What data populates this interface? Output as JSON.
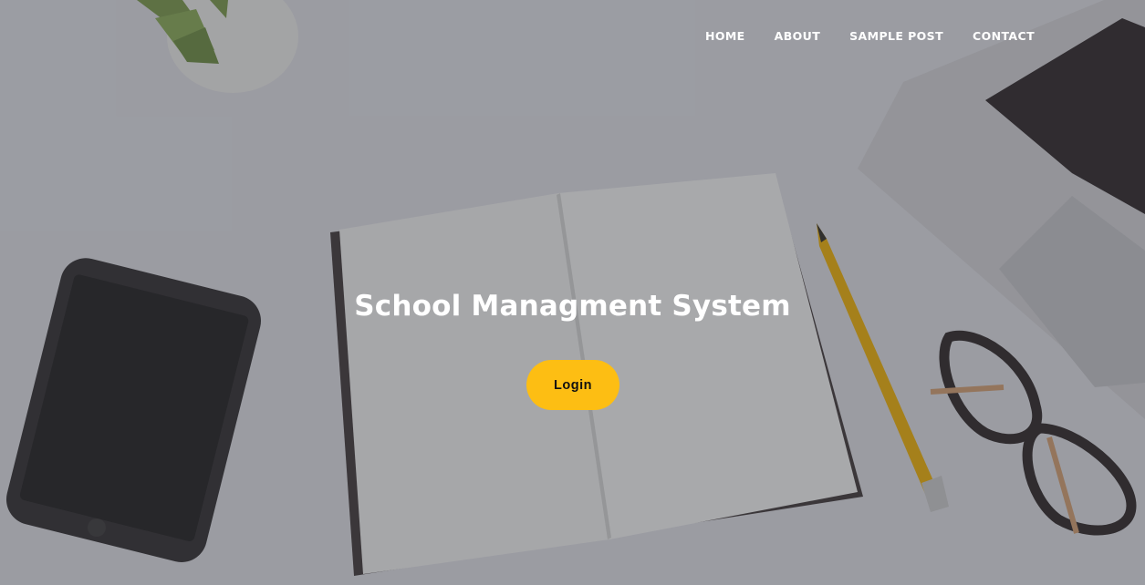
{
  "nav": {
    "items": [
      {
        "label": "HOME"
      },
      {
        "label": "ABOUT"
      },
      {
        "label": "SAMPLE POST"
      },
      {
        "label": "CONTACT"
      }
    ]
  },
  "hero": {
    "title": "School Managment System",
    "login_label": "Login"
  },
  "colors": {
    "accent": "#fdbe13",
    "overlay": "#373a41",
    "text": "#ffffff"
  }
}
